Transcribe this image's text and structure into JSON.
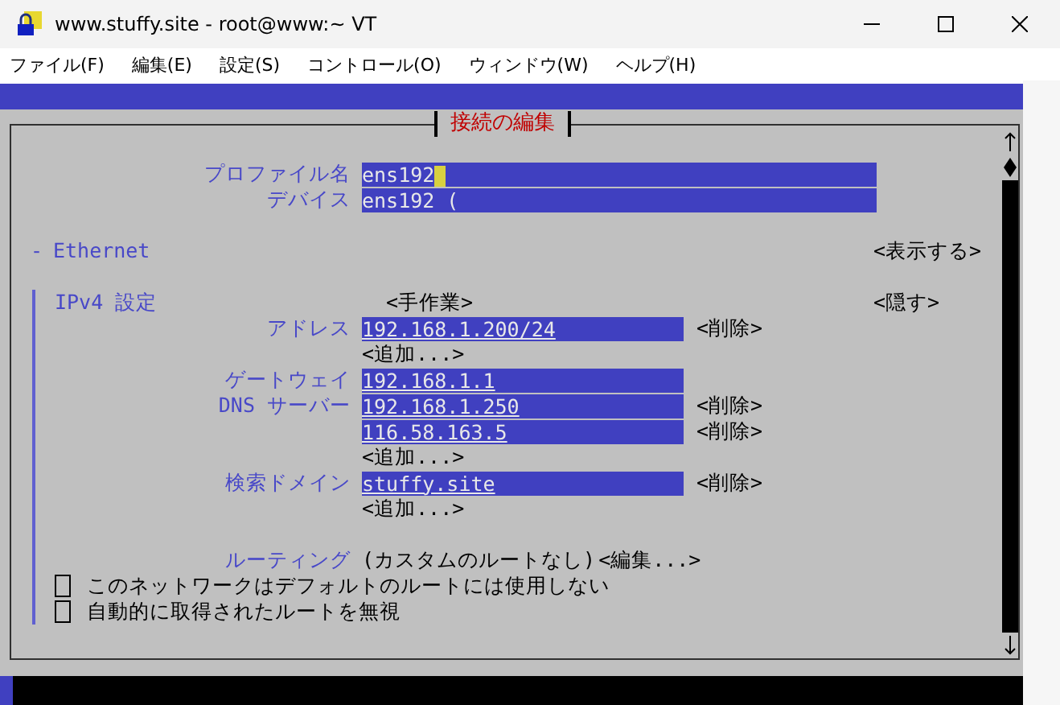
{
  "window": {
    "title": "www.stuffy.site - root@www:~ VT"
  },
  "menu": [
    "ファイル(F)",
    "編集(E)",
    "設定(S)",
    "コントロール(O)",
    "ウィンドウ(W)",
    "ヘルプ(H)"
  ],
  "dialog": {
    "title": "接続の編集",
    "profile": {
      "label": "プロファイル名",
      "value": "ens192"
    },
    "device": {
      "label": "デバイス",
      "value": "ens192 ("
    },
    "ethernet": {
      "marker": "-",
      "label": "Ethernet",
      "toggle": "<表示する>"
    },
    "ipv4": {
      "label": "IPv4 設定",
      "method": "<手作業>",
      "toggle": "<隠す>",
      "rows": [
        {
          "kind": "field",
          "label": "アドレス",
          "value": "192.168.1.200/24",
          "action": "<削除>"
        },
        {
          "kind": "add",
          "text": "<追加...>"
        },
        {
          "kind": "field",
          "label": "ゲートウェイ",
          "value": "192.168.1.1"
        },
        {
          "kind": "field",
          "label": "DNS サーバー",
          "value": "192.168.1.250",
          "action": "<削除>"
        },
        {
          "kind": "field",
          "value": "116.58.163.5",
          "action": "<削除>"
        },
        {
          "kind": "add",
          "text": "<追加...>"
        },
        {
          "kind": "field",
          "label": "検索ドメイン",
          "value": "stuffy.site",
          "action": "<削除>"
        },
        {
          "kind": "add",
          "text": "<追加...>"
        },
        {
          "kind": "spacer"
        },
        {
          "kind": "routing",
          "label": "ルーティング",
          "value": "(カスタムのルートなし)",
          "action": "<編集...>"
        },
        {
          "kind": "checkbox",
          "checked": false,
          "text": "このネットワークはデフォルトのルートには使用しない"
        },
        {
          "kind": "checkbox",
          "checked": false,
          "text": "自動的に取得されたルートを無視"
        }
      ]
    }
  }
}
